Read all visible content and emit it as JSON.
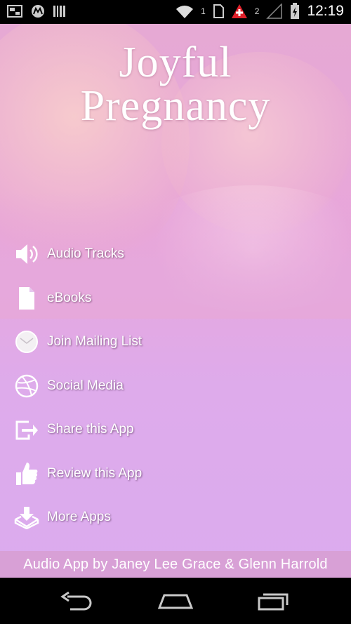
{
  "status_bar": {
    "time": "12:19",
    "sim1": "1",
    "sim2": "2",
    "icons": [
      "screenshot-icon",
      "motorola-icon",
      "barcode-icon",
      "wifi-icon",
      "sim-icon",
      "medical-alert-icon",
      "signal-icon",
      "battery-icon"
    ]
  },
  "app": {
    "title_line1": "Joyful",
    "title_line2": "Pregnancy",
    "colors": {
      "background": "#dbabee",
      "footer": "#d8a0d6",
      "text": "#ffffff"
    }
  },
  "menu": {
    "items": [
      {
        "label": "Audio Tracks",
        "icon": "speaker-icon"
      },
      {
        "label": "eBooks",
        "icon": "document-icon"
      },
      {
        "label": "Join Mailing List",
        "icon": "mail-icon"
      },
      {
        "label": "Social Media",
        "icon": "dribbble-icon"
      },
      {
        "label": "Share this App",
        "icon": "share-icon"
      },
      {
        "label": "Review this App",
        "icon": "thumbs-up-icon"
      },
      {
        "label": "More Apps",
        "icon": "download-icon"
      }
    ]
  },
  "footer": {
    "text": "Audio App by Janey Lee Grace & Glenn Harrold"
  },
  "nav_bar": {
    "buttons": [
      "back-icon",
      "home-icon",
      "recents-icon"
    ]
  }
}
